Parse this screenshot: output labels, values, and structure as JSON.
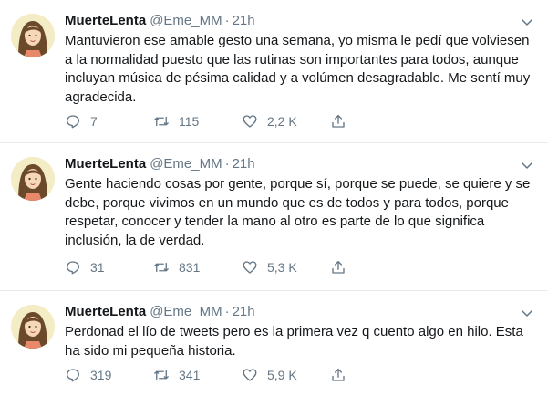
{
  "tweets": [
    {
      "name": "MuerteLenta",
      "handle": "@Eme_MM",
      "dot": "·",
      "time": "21h",
      "text": "Mantuvieron ese amable gesto una semana, yo misma le pedí que volviesen a la normalidad puesto que las rutinas son importantes para todos, aunque incluyan música de pésima calidad y a volúmen desagradable. Me sentí muy agradecida.",
      "replies": "7",
      "retweets": "115",
      "likes": "2,2 K"
    },
    {
      "name": "MuerteLenta",
      "handle": "@Eme_MM",
      "dot": "·",
      "time": "21h",
      "text": "Gente haciendo cosas por gente, porque sí, porque se puede, se quiere y se debe, porque vivimos en un mundo que es de todos y para todos, porque respetar, conocer y tender la mano al otro es parte de lo que significa inclusión, la de verdad.",
      "replies": "31",
      "retweets": "831",
      "likes": "5,3 K"
    },
    {
      "name": "MuerteLenta",
      "handle": "@Eme_MM",
      "dot": "·",
      "time": "21h",
      "text": "Perdonad el lío de tweets pero es la primera vez q cuento algo en hilo. Esta ha sido mi pequeña historia.",
      "replies": "319",
      "retweets": "341",
      "likes": "5,9 K"
    }
  ],
  "icons": {
    "reply": "reply-icon",
    "retweet": "retweet-icon",
    "like": "heart-icon",
    "share": "share-icon",
    "more": "chevron-down-icon"
  },
  "colors": {
    "text": "#14171a",
    "secondary": "#657786",
    "divider": "#e6ecf0"
  }
}
